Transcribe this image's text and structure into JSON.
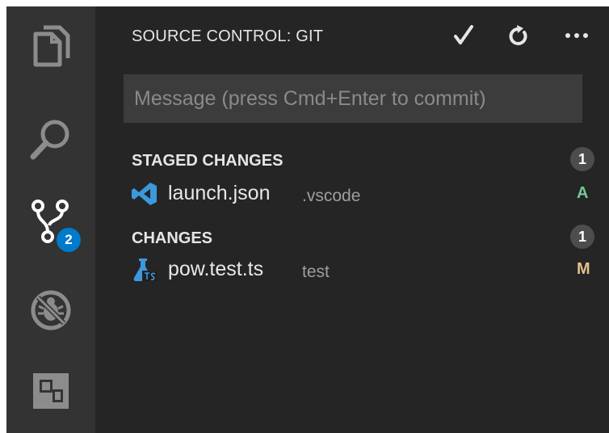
{
  "activity_bar": {
    "items": [
      {
        "icon": "files-icon"
      },
      {
        "icon": "search-icon"
      },
      {
        "icon": "source-control-icon",
        "badge": "2"
      },
      {
        "icon": "debug-icon"
      },
      {
        "icon": "extensions-icon"
      }
    ],
    "badge_color": "#007acc"
  },
  "panel": {
    "title": "SOURCE CONTROL: GIT",
    "actions": [
      {
        "icon": "check-icon",
        "glyph": "✓"
      },
      {
        "icon": "refresh-icon"
      },
      {
        "icon": "more-icon",
        "glyph": "•••"
      }
    ],
    "commit_input": {
      "placeholder": "Message (press Cmd+Enter to commit)",
      "value": ""
    },
    "sections": [
      {
        "label": "STAGED CHANGES",
        "count": "1",
        "files": [
          {
            "name": "launch.json",
            "dir": ".vscode",
            "status": "A",
            "status_color": "#73c991",
            "icon": "vscode-icon"
          }
        ]
      },
      {
        "label": "CHANGES",
        "count": "1",
        "files": [
          {
            "name": "pow.test.ts",
            "dir": "test",
            "status": "M",
            "status_color": "#e2c08d",
            "icon": "typescript-test-icon"
          }
        ]
      }
    ]
  }
}
